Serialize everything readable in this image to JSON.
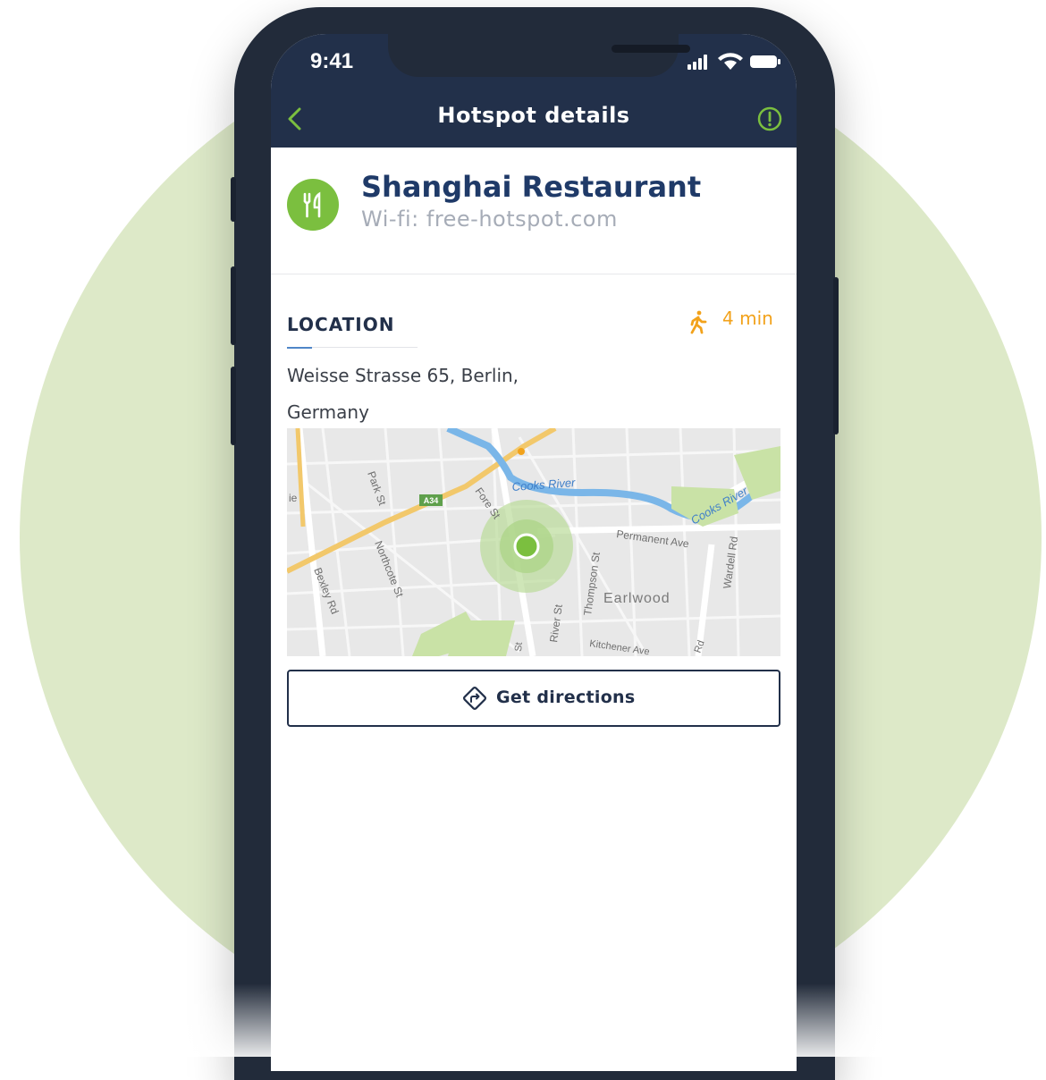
{
  "status_bar": {
    "time": "9:41"
  },
  "nav": {
    "title": "Hotspot details"
  },
  "hotspot": {
    "name": "Shanghai Restaurant",
    "wifi": "Wi-fi: free-hotspot.com"
  },
  "location": {
    "section_title": "LOCATION",
    "walk_time": "4 min",
    "address_line1": "Weisse Strasse 65, Berlin,",
    "address_line2": "Germany"
  },
  "map": {
    "river_label": "Cooks River",
    "road_badge": "A34",
    "suburb": "Earlwood",
    "street_names": {
      "park": "Park St",
      "fore": "Fore St",
      "northcote": "Northcote St",
      "bexley": "Bexley Rd",
      "permanent": "Permanent Ave",
      "thompson": "Thompson St",
      "river": "River St",
      "wardell": "Wardell Rd",
      "kitchener": "Kitchener Ave",
      "rd": "Rd",
      "st": "St",
      "ie": "ie"
    }
  },
  "actions": {
    "get_directions": "Get directions"
  },
  "colors": {
    "navbar": "#22304a",
    "accent_green": "#7bbf3f",
    "title_blue": "#1f3a68",
    "walk_orange": "#f2a21b",
    "background_circle": "#dde9c8"
  }
}
